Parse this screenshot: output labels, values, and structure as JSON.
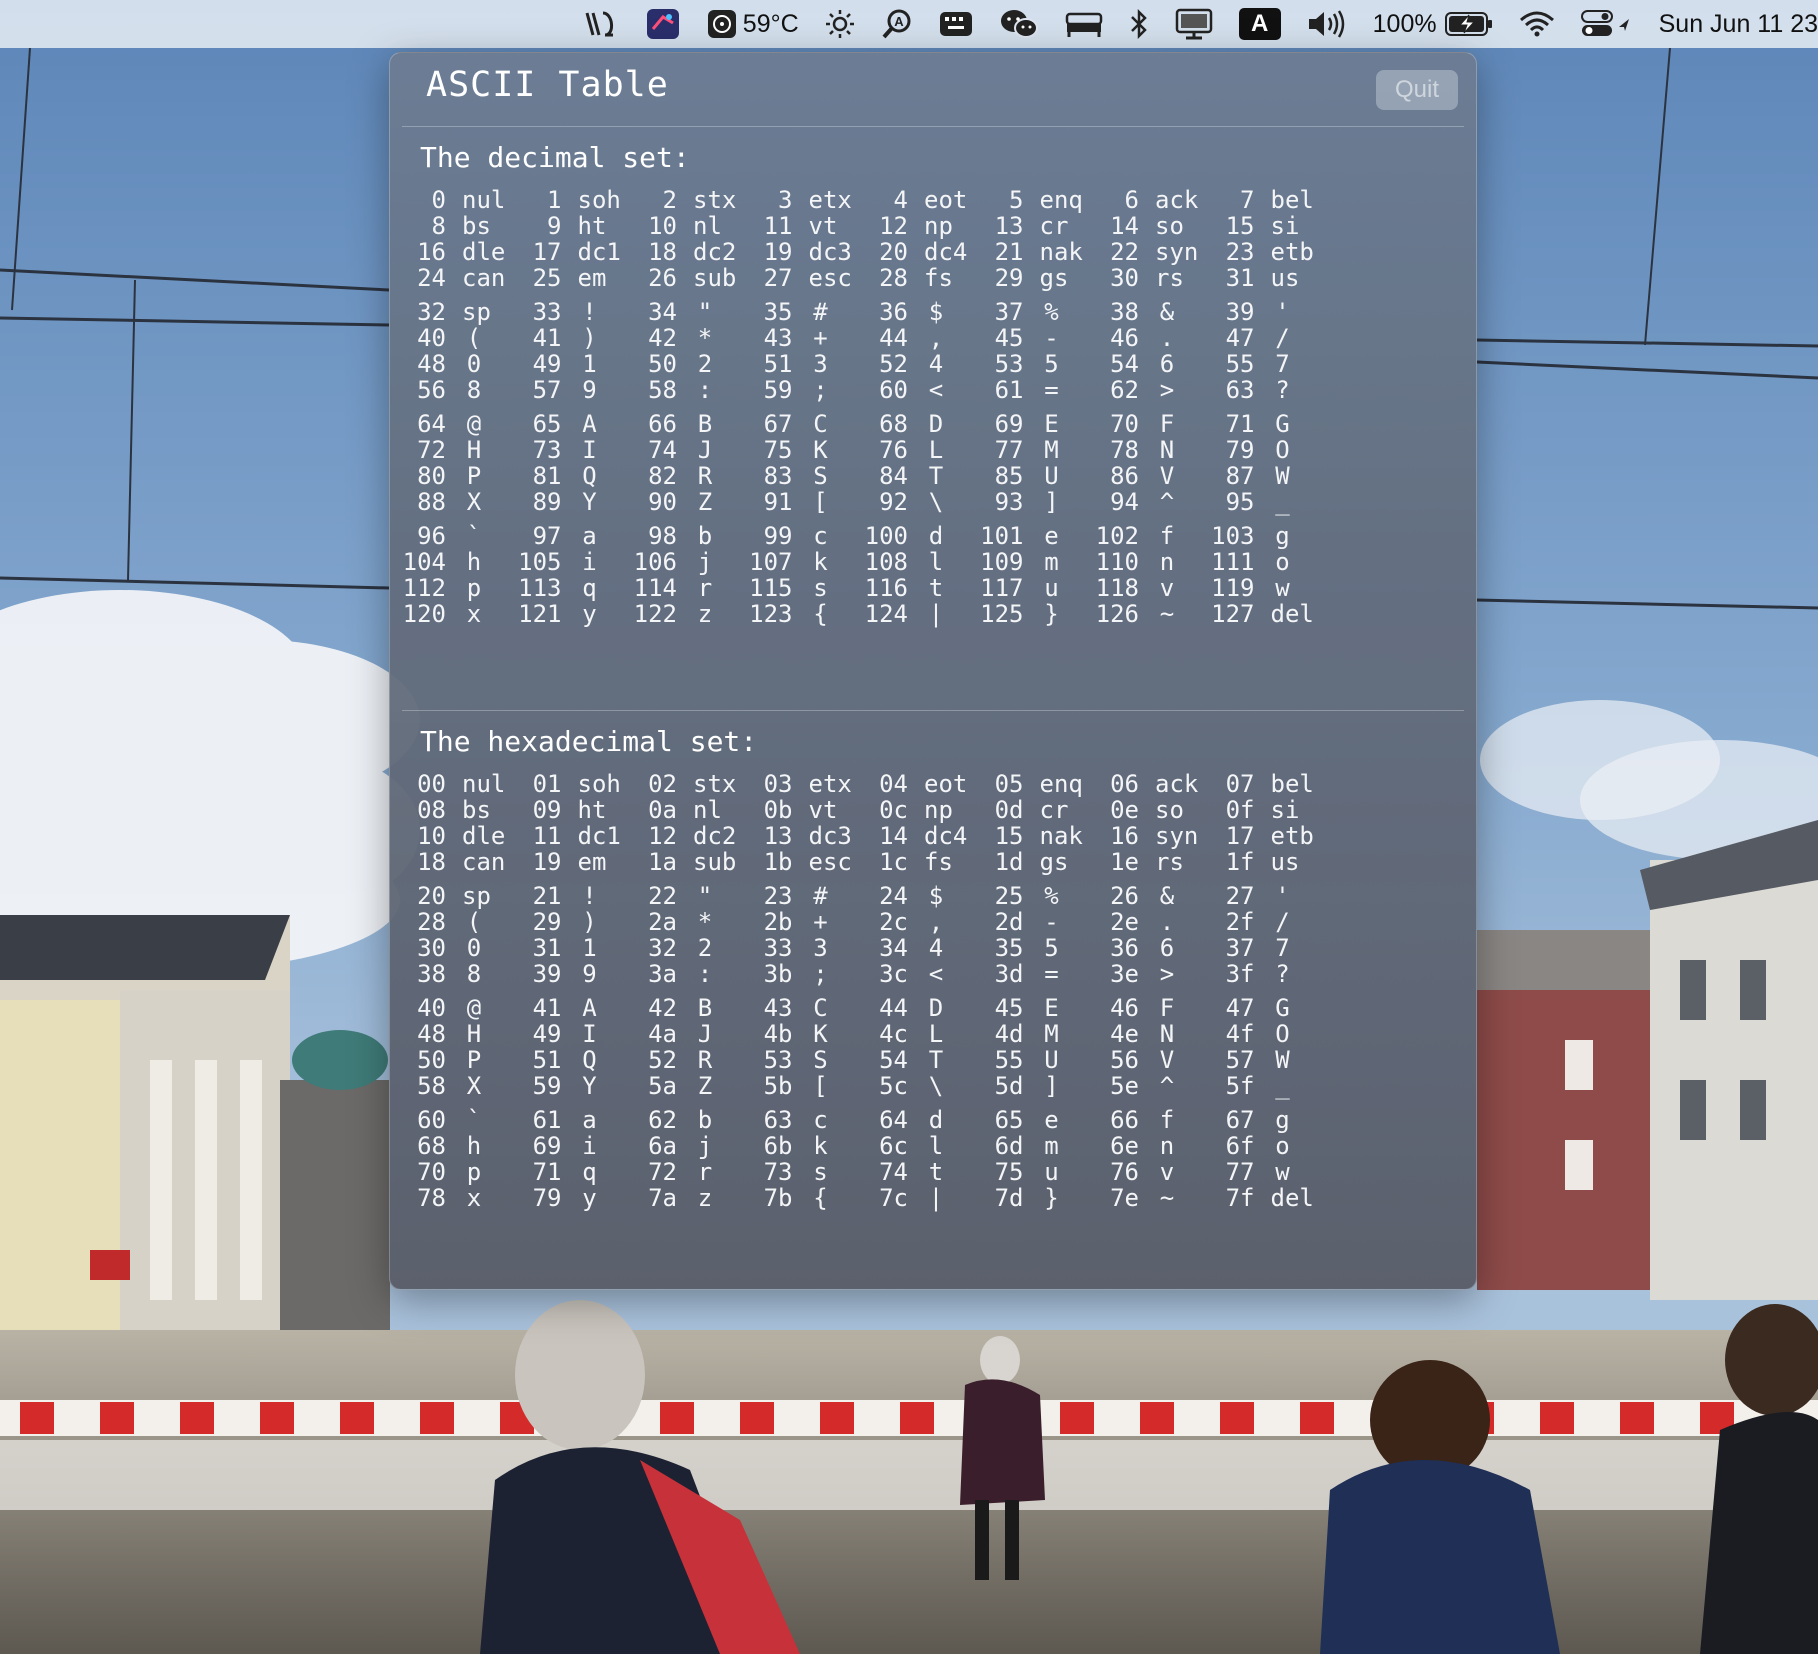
{
  "menubar": {
    "temperature": "59°C",
    "battery_percent": "100%",
    "input_source": "A",
    "clock": "Sun Jun 11  23"
  },
  "window": {
    "title": "ASCII Table",
    "quit_label": "Quit",
    "decimal_heading": "The decimal set:",
    "hex_heading": "The hexadecimal set:"
  },
  "chars": [
    "nul",
    "soh",
    "stx",
    "etx",
    "eot",
    "enq",
    "ack",
    "bel",
    "bs",
    "ht",
    "nl",
    "vt",
    "np",
    "cr",
    "so",
    "si",
    "dle",
    "dc1",
    "dc2",
    "dc3",
    "dc4",
    "nak",
    "syn",
    "etb",
    "can",
    "em",
    "sub",
    "esc",
    "fs",
    "gs",
    "rs",
    "us",
    "sp",
    "!",
    "\"",
    "#",
    "$",
    "%",
    "&",
    "'",
    "(",
    ")",
    "*",
    "+",
    ",",
    "-",
    ".",
    "/",
    "0",
    "1",
    "2",
    "3",
    "4",
    "5",
    "6",
    "7",
    "8",
    "9",
    ":",
    ";",
    "<",
    "=",
    ">",
    "?",
    "@",
    "A",
    "B",
    "C",
    "D",
    "E",
    "F",
    "G",
    "H",
    "I",
    "J",
    "K",
    "L",
    "M",
    "N",
    "O",
    "P",
    "Q",
    "R",
    "S",
    "T",
    "U",
    "V",
    "W",
    "X",
    "Y",
    "Z",
    "[",
    "\\",
    "]",
    "^",
    "_",
    "`",
    "a",
    "b",
    "c",
    "d",
    "e",
    "f",
    "g",
    "h",
    "i",
    "j",
    "k",
    "l",
    "m",
    "n",
    "o",
    "p",
    "q",
    "r",
    "s",
    "t",
    "u",
    "v",
    "w",
    "x",
    "y",
    "z",
    "{",
    "|",
    "}",
    "~",
    "del"
  ],
  "decimal_codes": [
    "0",
    "1",
    "2",
    "3",
    "4",
    "5",
    "6",
    "7",
    "8",
    "9",
    "10",
    "11",
    "12",
    "13",
    "14",
    "15",
    "16",
    "17",
    "18",
    "19",
    "20",
    "21",
    "22",
    "23",
    "24",
    "25",
    "26",
    "27",
    "28",
    "29",
    "30",
    "31",
    "32",
    "33",
    "34",
    "35",
    "36",
    "37",
    "38",
    "39",
    "40",
    "41",
    "42",
    "43",
    "44",
    "45",
    "46",
    "47",
    "48",
    "49",
    "50",
    "51",
    "52",
    "53",
    "54",
    "55",
    "56",
    "57",
    "58",
    "59",
    "60",
    "61",
    "62",
    "63",
    "64",
    "65",
    "66",
    "67",
    "68",
    "69",
    "70",
    "71",
    "72",
    "73",
    "74",
    "75",
    "76",
    "77",
    "78",
    "79",
    "80",
    "81",
    "82",
    "83",
    "84",
    "85",
    "86",
    "87",
    "88",
    "89",
    "90",
    "91",
    "92",
    "93",
    "94",
    "95",
    "96",
    "97",
    "98",
    "99",
    "100",
    "101",
    "102",
    "103",
    "104",
    "105",
    "106",
    "107",
    "108",
    "109",
    "110",
    "111",
    "112",
    "113",
    "114",
    "115",
    "116",
    "117",
    "118",
    "119",
    "120",
    "121",
    "122",
    "123",
    "124",
    "125",
    "126",
    "127"
  ],
  "hex_codes": [
    "00",
    "01",
    "02",
    "03",
    "04",
    "05",
    "06",
    "07",
    "08",
    "09",
    "0a",
    "0b",
    "0c",
    "0d",
    "0e",
    "0f",
    "10",
    "11",
    "12",
    "13",
    "14",
    "15",
    "16",
    "17",
    "18",
    "19",
    "1a",
    "1b",
    "1c",
    "1d",
    "1e",
    "1f",
    "20",
    "21",
    "22",
    "23",
    "24",
    "25",
    "26",
    "27",
    "28",
    "29",
    "2a",
    "2b",
    "2c",
    "2d",
    "2e",
    "2f",
    "30",
    "31",
    "32",
    "33",
    "34",
    "35",
    "36",
    "37",
    "38",
    "39",
    "3a",
    "3b",
    "3c",
    "3d",
    "3e",
    "3f",
    "40",
    "41",
    "42",
    "43",
    "44",
    "45",
    "46",
    "47",
    "48",
    "49",
    "4a",
    "4b",
    "4c",
    "4d",
    "4e",
    "4f",
    "50",
    "51",
    "52",
    "53",
    "54",
    "55",
    "56",
    "57",
    "58",
    "59",
    "5a",
    "5b",
    "5c",
    "5d",
    "5e",
    "5f",
    "60",
    "61",
    "62",
    "63",
    "64",
    "65",
    "66",
    "67",
    "68",
    "69",
    "6a",
    "6b",
    "6c",
    "6d",
    "6e",
    "6f",
    "70",
    "71",
    "72",
    "73",
    "74",
    "75",
    "76",
    "77",
    "78",
    "79",
    "7a",
    "7b",
    "7c",
    "7d",
    "7e",
    "7f"
  ],
  "icons": {
    "menubar": [
      "alfred-icon",
      "app-icon",
      "cpu-fan-icon",
      "brightness-icon",
      "spotlight-icon",
      "keyboard-icon",
      "wechat-icon",
      "bed-icon",
      "bluetooth-icon",
      "display-icon",
      "input-source-icon",
      "volume-icon",
      "battery-charging-icon",
      "wifi-icon",
      "control-center-icon"
    ]
  },
  "colors": {
    "panel_text": "#f4f5f7",
    "menubar_bg": "#dde5f0"
  }
}
